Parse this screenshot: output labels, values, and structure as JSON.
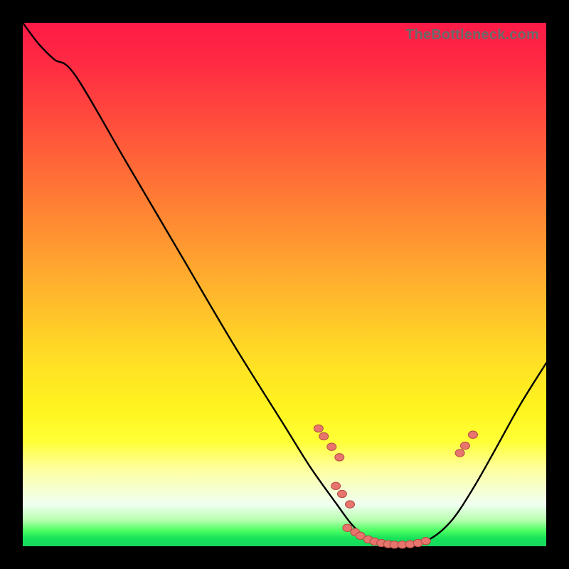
{
  "watermark": "TheBottleneck.com",
  "colors": {
    "gradient_top": "#ff1a47",
    "gradient_mid": "#ffe324",
    "gradient_bottom": "#16d85c",
    "curve": "#000000",
    "dot_fill": "#e7746d",
    "dot_stroke": "#b24a44",
    "background": "#000000"
  },
  "chart_data": {
    "type": "line",
    "title": "",
    "xlabel": "",
    "ylabel": "",
    "xlim": [
      0,
      100
    ],
    "ylim": [
      0,
      100
    ],
    "grid": false,
    "curve": [
      {
        "x": 0,
        "y": 100
      },
      {
        "x": 3,
        "y": 96
      },
      {
        "x": 6,
        "y": 93
      },
      {
        "x": 10,
        "y": 90
      },
      {
        "x": 20,
        "y": 73
      },
      {
        "x": 30,
        "y": 56
      },
      {
        "x": 40,
        "y": 39
      },
      {
        "x": 50,
        "y": 23
      },
      {
        "x": 55,
        "y": 15
      },
      {
        "x": 60,
        "y": 8
      },
      {
        "x": 63,
        "y": 4
      },
      {
        "x": 66,
        "y": 1.5
      },
      {
        "x": 70,
        "y": 0.3
      },
      {
        "x": 74,
        "y": 0.3
      },
      {
        "x": 78,
        "y": 1.5
      },
      {
        "x": 82,
        "y": 5
      },
      {
        "x": 86,
        "y": 11
      },
      {
        "x": 90,
        "y": 18
      },
      {
        "x": 95,
        "y": 27
      },
      {
        "x": 100,
        "y": 35
      }
    ],
    "markers": [
      {
        "x": 56.5,
        "y": 22.5
      },
      {
        "x": 57.5,
        "y": 21.0
      },
      {
        "x": 59.0,
        "y": 19.0
      },
      {
        "x": 60.5,
        "y": 17.0
      },
      {
        "x": 59.8,
        "y": 11.5
      },
      {
        "x": 61.0,
        "y": 10.0
      },
      {
        "x": 62.5,
        "y": 8.0
      },
      {
        "x": 62.0,
        "y": 3.5
      },
      {
        "x": 63.5,
        "y": 2.7
      },
      {
        "x": 64.5,
        "y": 2.0
      },
      {
        "x": 66.0,
        "y": 1.3
      },
      {
        "x": 67.2,
        "y": 0.9
      },
      {
        "x": 68.5,
        "y": 0.6
      },
      {
        "x": 69.8,
        "y": 0.4
      },
      {
        "x": 71.0,
        "y": 0.3
      },
      {
        "x": 72.5,
        "y": 0.3
      },
      {
        "x": 74.0,
        "y": 0.4
      },
      {
        "x": 75.5,
        "y": 0.6
      },
      {
        "x": 77.0,
        "y": 1.0
      },
      {
        "x": 83.5,
        "y": 17.8
      },
      {
        "x": 84.5,
        "y": 19.2
      },
      {
        "x": 86.0,
        "y": 21.3
      }
    ]
  }
}
